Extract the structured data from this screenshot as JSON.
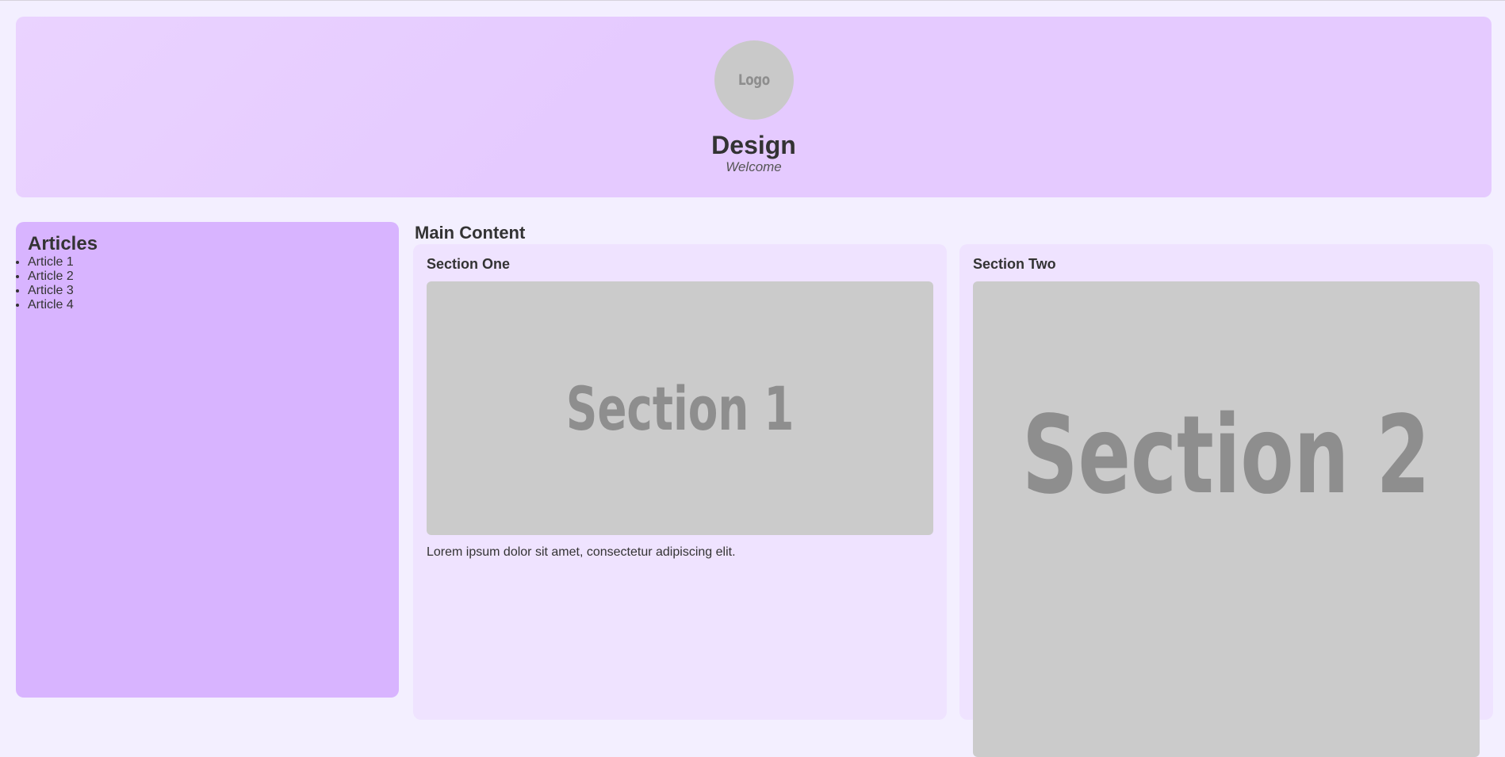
{
  "header": {
    "logo_text": "Logo",
    "title": "Design",
    "tagline": "Welcome"
  },
  "sidebar": {
    "heading": "Articles",
    "items": [
      {
        "label": "Article 1"
      },
      {
        "label": "Article 2"
      },
      {
        "label": "Article 3"
      },
      {
        "label": "Article 4"
      }
    ]
  },
  "main": {
    "title": "Main Content",
    "sections": [
      {
        "heading": "Section One",
        "image_text": "Section 1",
        "body": "Lorem ipsum dolor sit amet, consectetur adipiscing elit."
      },
      {
        "heading": "Section Two",
        "image_text": "Section 2"
      }
    ]
  },
  "colors": {
    "page_background": "#f3efff",
    "header_background": "#e5caff",
    "sidebar_background": "#d8b4ff",
    "card_background": "#efe3ff",
    "placeholder": "#cbcbcb"
  }
}
